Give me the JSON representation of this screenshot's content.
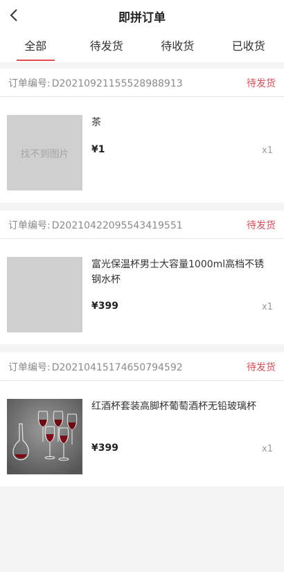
{
  "header": {
    "title": "即拼订单"
  },
  "tabs": [
    {
      "label": "全部",
      "active": true
    },
    {
      "label": "待发货",
      "active": false
    },
    {
      "label": "待收货",
      "active": false
    },
    {
      "label": "已收货",
      "active": false
    }
  ],
  "orders": [
    {
      "order_label": "订单编号:",
      "order_no": "D20210921155528988913",
      "status": "待发货",
      "item": {
        "name": "茶",
        "price": "¥1",
        "qty": "x1",
        "image_placeholder": "找不到图片"
      }
    },
    {
      "order_label": "订单编号:",
      "order_no": "D20210422095543419551",
      "status": "待发货",
      "item": {
        "name": "富光保温杯男士大容量1000ml高档不锈钢水杯",
        "price": "¥399",
        "qty": "x1"
      }
    },
    {
      "order_label": "订单编号:",
      "order_no": "D20210415174650794592",
      "status": "待发货",
      "item": {
        "name": "红酒杯套装高脚杯葡萄酒杯无铅玻璃杯",
        "price": "¥399",
        "qty": "x1"
      }
    }
  ],
  "colors": {
    "accent": "#e34c4c",
    "status": "#d94b58",
    "background": "#f4f4f4"
  }
}
